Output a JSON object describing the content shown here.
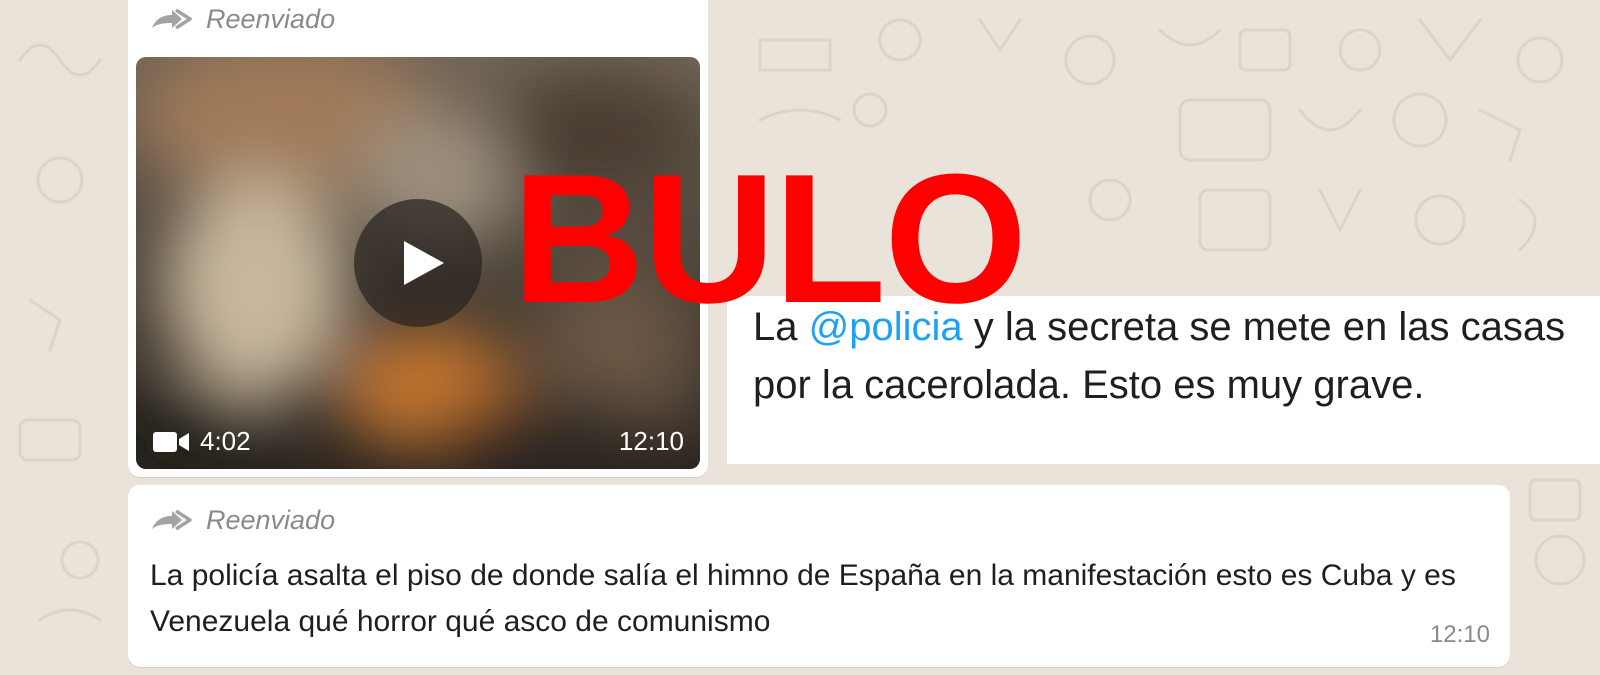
{
  "colors": {
    "wallpaper": "#e9e3da",
    "bubble": "#ffffff",
    "meta_text": "#8a8a8a",
    "mention": "#1da1f2",
    "stamp": "#ff0000"
  },
  "video_message": {
    "forwarded_label": "Reenviado",
    "duration": "4:02",
    "time": "12:10",
    "icons": [
      "forward-icon",
      "play-icon",
      "video-camera-icon"
    ]
  },
  "tweet": {
    "before_mention": "La ",
    "mention": "@policia",
    "after_mention": " y la secreta se mete en las casas por la cacerolada. Esto es muy grave."
  },
  "text_message": {
    "forwarded_label": "Reenviado",
    "text": "La policía asalta el piso de donde salía el himno de España en la manifestación esto es Cuba y es Venezuela qué horror qué asco de comunismo",
    "time": "12:10"
  },
  "stamp": {
    "label": "BULO"
  }
}
